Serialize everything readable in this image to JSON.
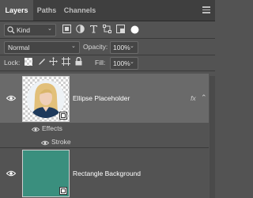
{
  "tabs": [
    "Layers",
    "Paths",
    "Channels"
  ],
  "filter": {
    "kind_label": "Kind"
  },
  "blend": {
    "mode": "Normal",
    "opacity_label": "Opacity:",
    "opacity_value": "100%"
  },
  "lock": {
    "label": "Lock:",
    "fill_label": "Fill:",
    "fill_value": "100%"
  },
  "layers": [
    {
      "name": "Ellipse Placeholder",
      "fx": "fx",
      "effects_label": "Effects",
      "stroke_label": "Stroke"
    },
    {
      "name": "Rectangle Background",
      "color": "#3a8f7e"
    }
  ],
  "colors": {
    "panel": "#535353",
    "selected_row": "#6a6a6a",
    "teal": "#3a8f7e"
  }
}
